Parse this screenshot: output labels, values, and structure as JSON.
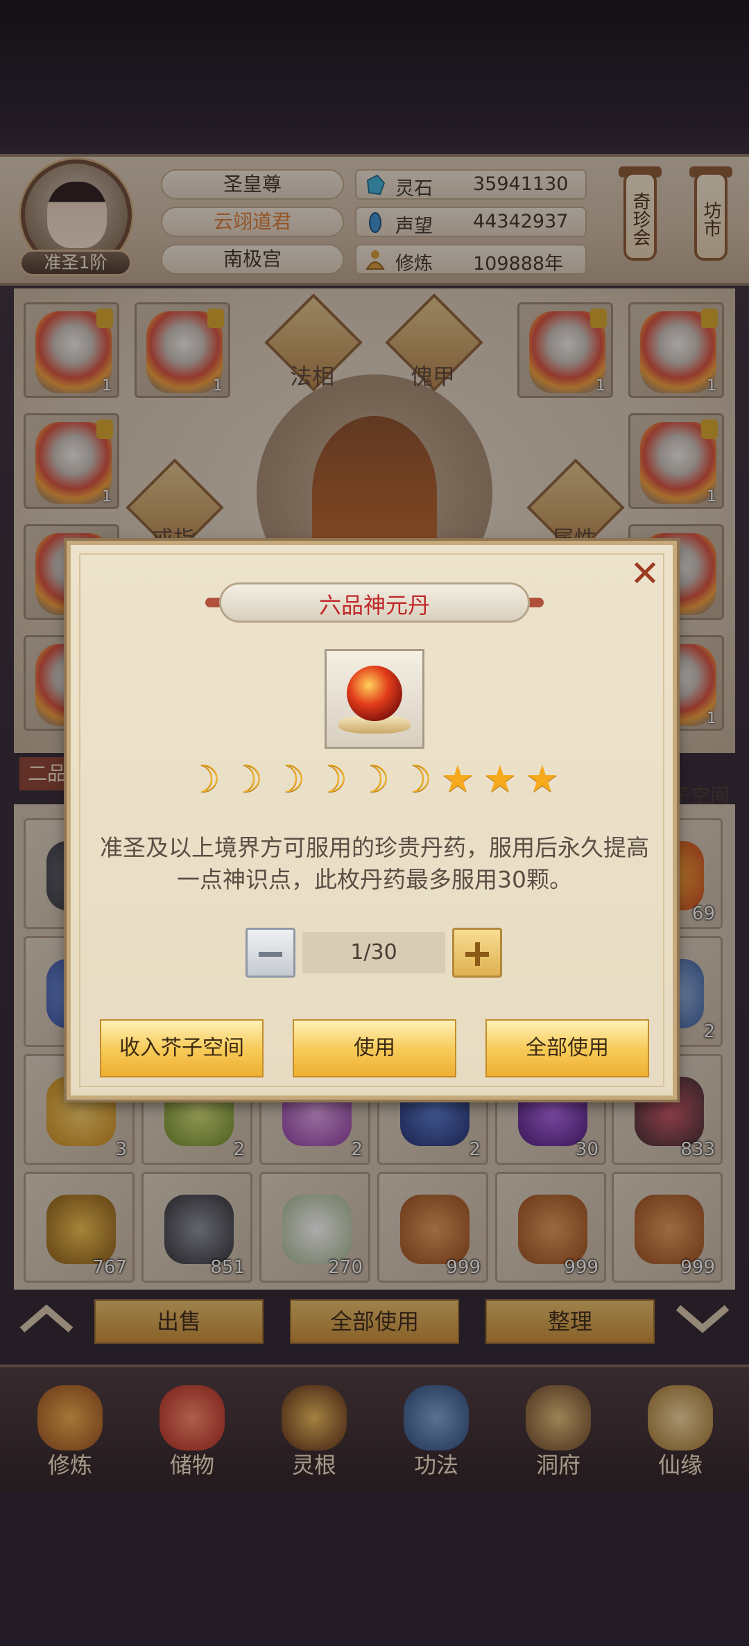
{
  "header": {
    "rank": "准圣1阶",
    "titles": [
      "圣皇尊",
      "云翊道君",
      "南极宫"
    ],
    "title_colors": [
      "#3f332a",
      "#d77a30",
      "#3f332a"
    ],
    "resources": [
      {
        "label": "灵石",
        "value": "35941130",
        "icon": "spirit-stone-icon"
      },
      {
        "label": "声望",
        "value": "44342937",
        "icon": "reputation-icon"
      },
      {
        "label": "修炼",
        "value": "109888年",
        "icon": "cultivation-icon"
      }
    ],
    "lantern_left": "奇珍会",
    "lantern_right": "坊市"
  },
  "equip": {
    "labels": {
      "fa_xiang": "法相",
      "kui_jia": "傀甲",
      "jie_zhi": "戒指",
      "shu_xing": "属性"
    },
    "slot_count": "1"
  },
  "bag": {
    "tab_label": "二品",
    "right_label": "子空间",
    "row3_counts": [
      "3",
      "2",
      "2",
      "2",
      "30",
      "833"
    ],
    "row4_counts": [
      "767",
      "851",
      "270",
      "999",
      "999",
      "999"
    ],
    "side_counts": [
      "69",
      "2"
    ],
    "actions": [
      "出售",
      "全部使用",
      "整理"
    ]
  },
  "nav": {
    "items": [
      "修炼",
      "储物",
      "灵根",
      "功法",
      "洞府",
      "仙缘"
    ],
    "active": "储物"
  },
  "modal": {
    "title": "六品神元丹",
    "close": "✕",
    "moons": 6,
    "stars": 3,
    "description": "准圣及以上境界方可服用的珍贵丹药，服用后永久提高一点神识点，此枚丹药最多服用30颗。",
    "quantity": "1/30",
    "buttons": [
      "收入芥子空间",
      "使用",
      "全部使用"
    ]
  }
}
